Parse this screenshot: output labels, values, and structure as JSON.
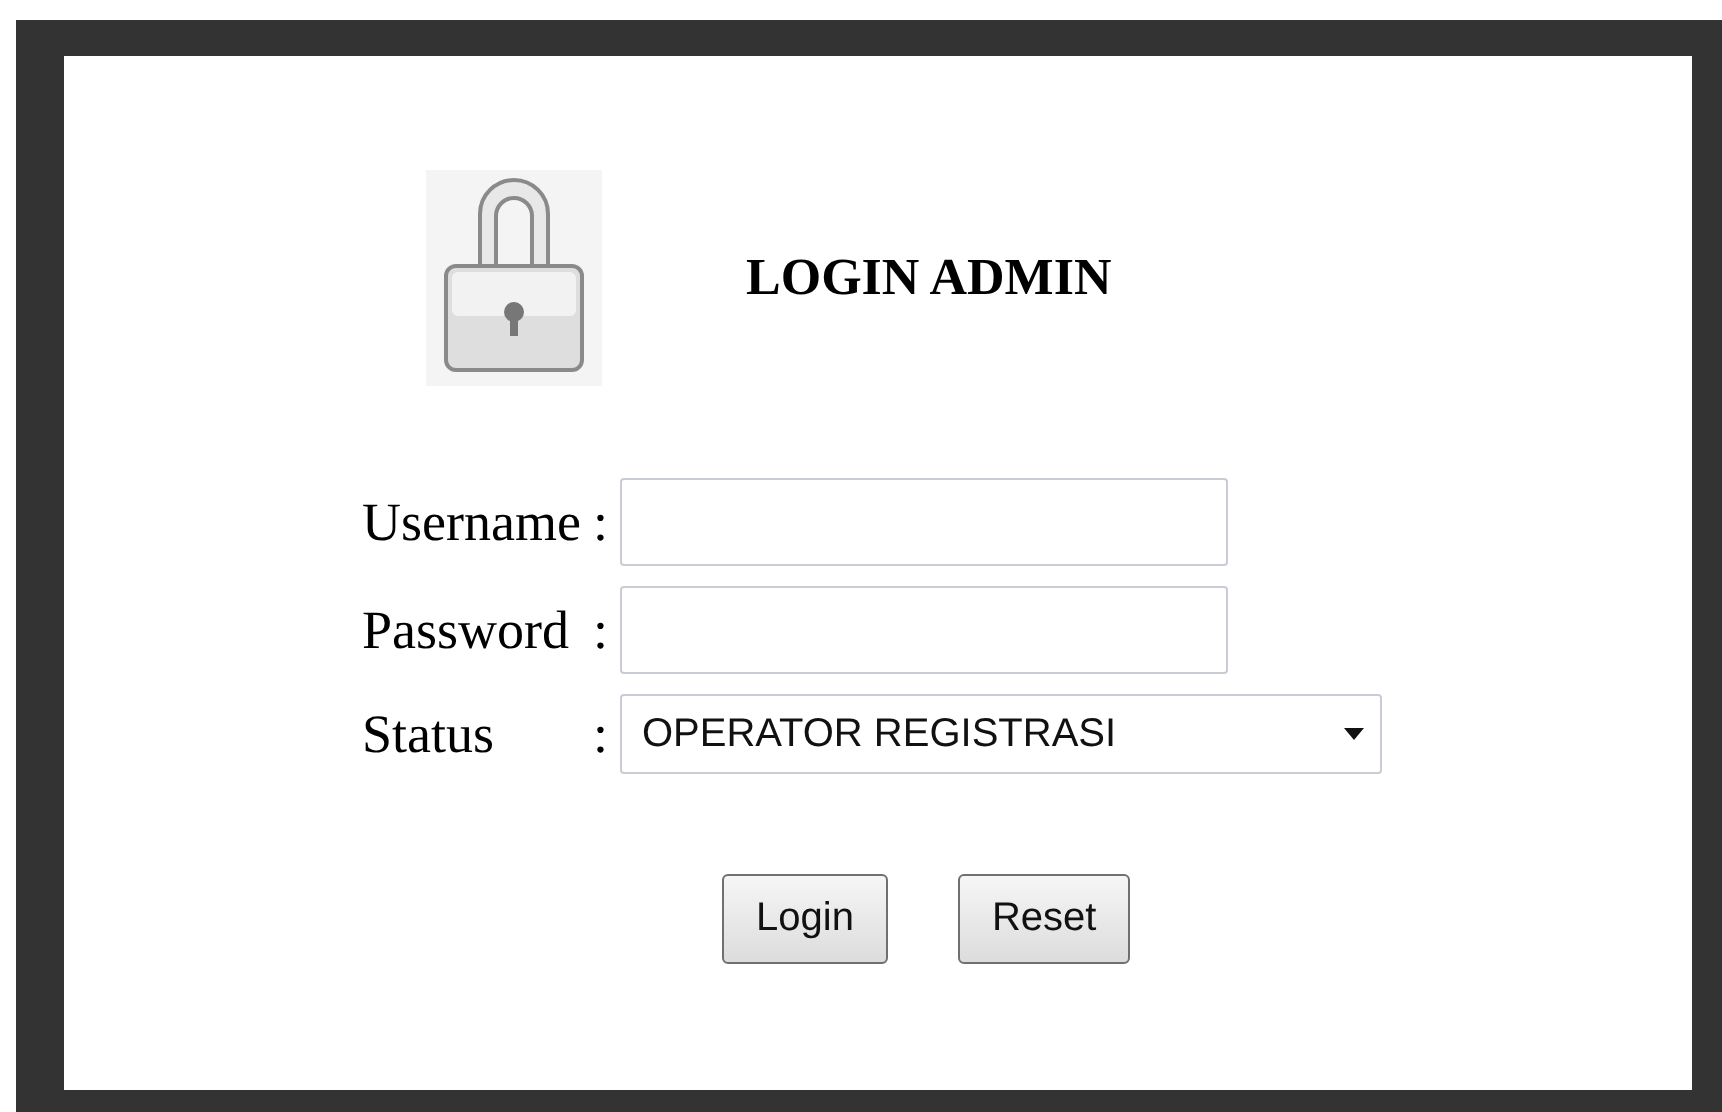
{
  "title": "LOGIN ADMIN",
  "fields": [
    {
      "kind": "text",
      "label": "Username",
      "separator": ":"
    },
    {
      "kind": "password",
      "label": "Password",
      "separator": ":"
    },
    {
      "kind": "select",
      "label": "Status",
      "separator": ":",
      "value": "OPERATOR REGISTRASI"
    }
  ],
  "buttons": [
    "Login",
    "Reset"
  ]
}
